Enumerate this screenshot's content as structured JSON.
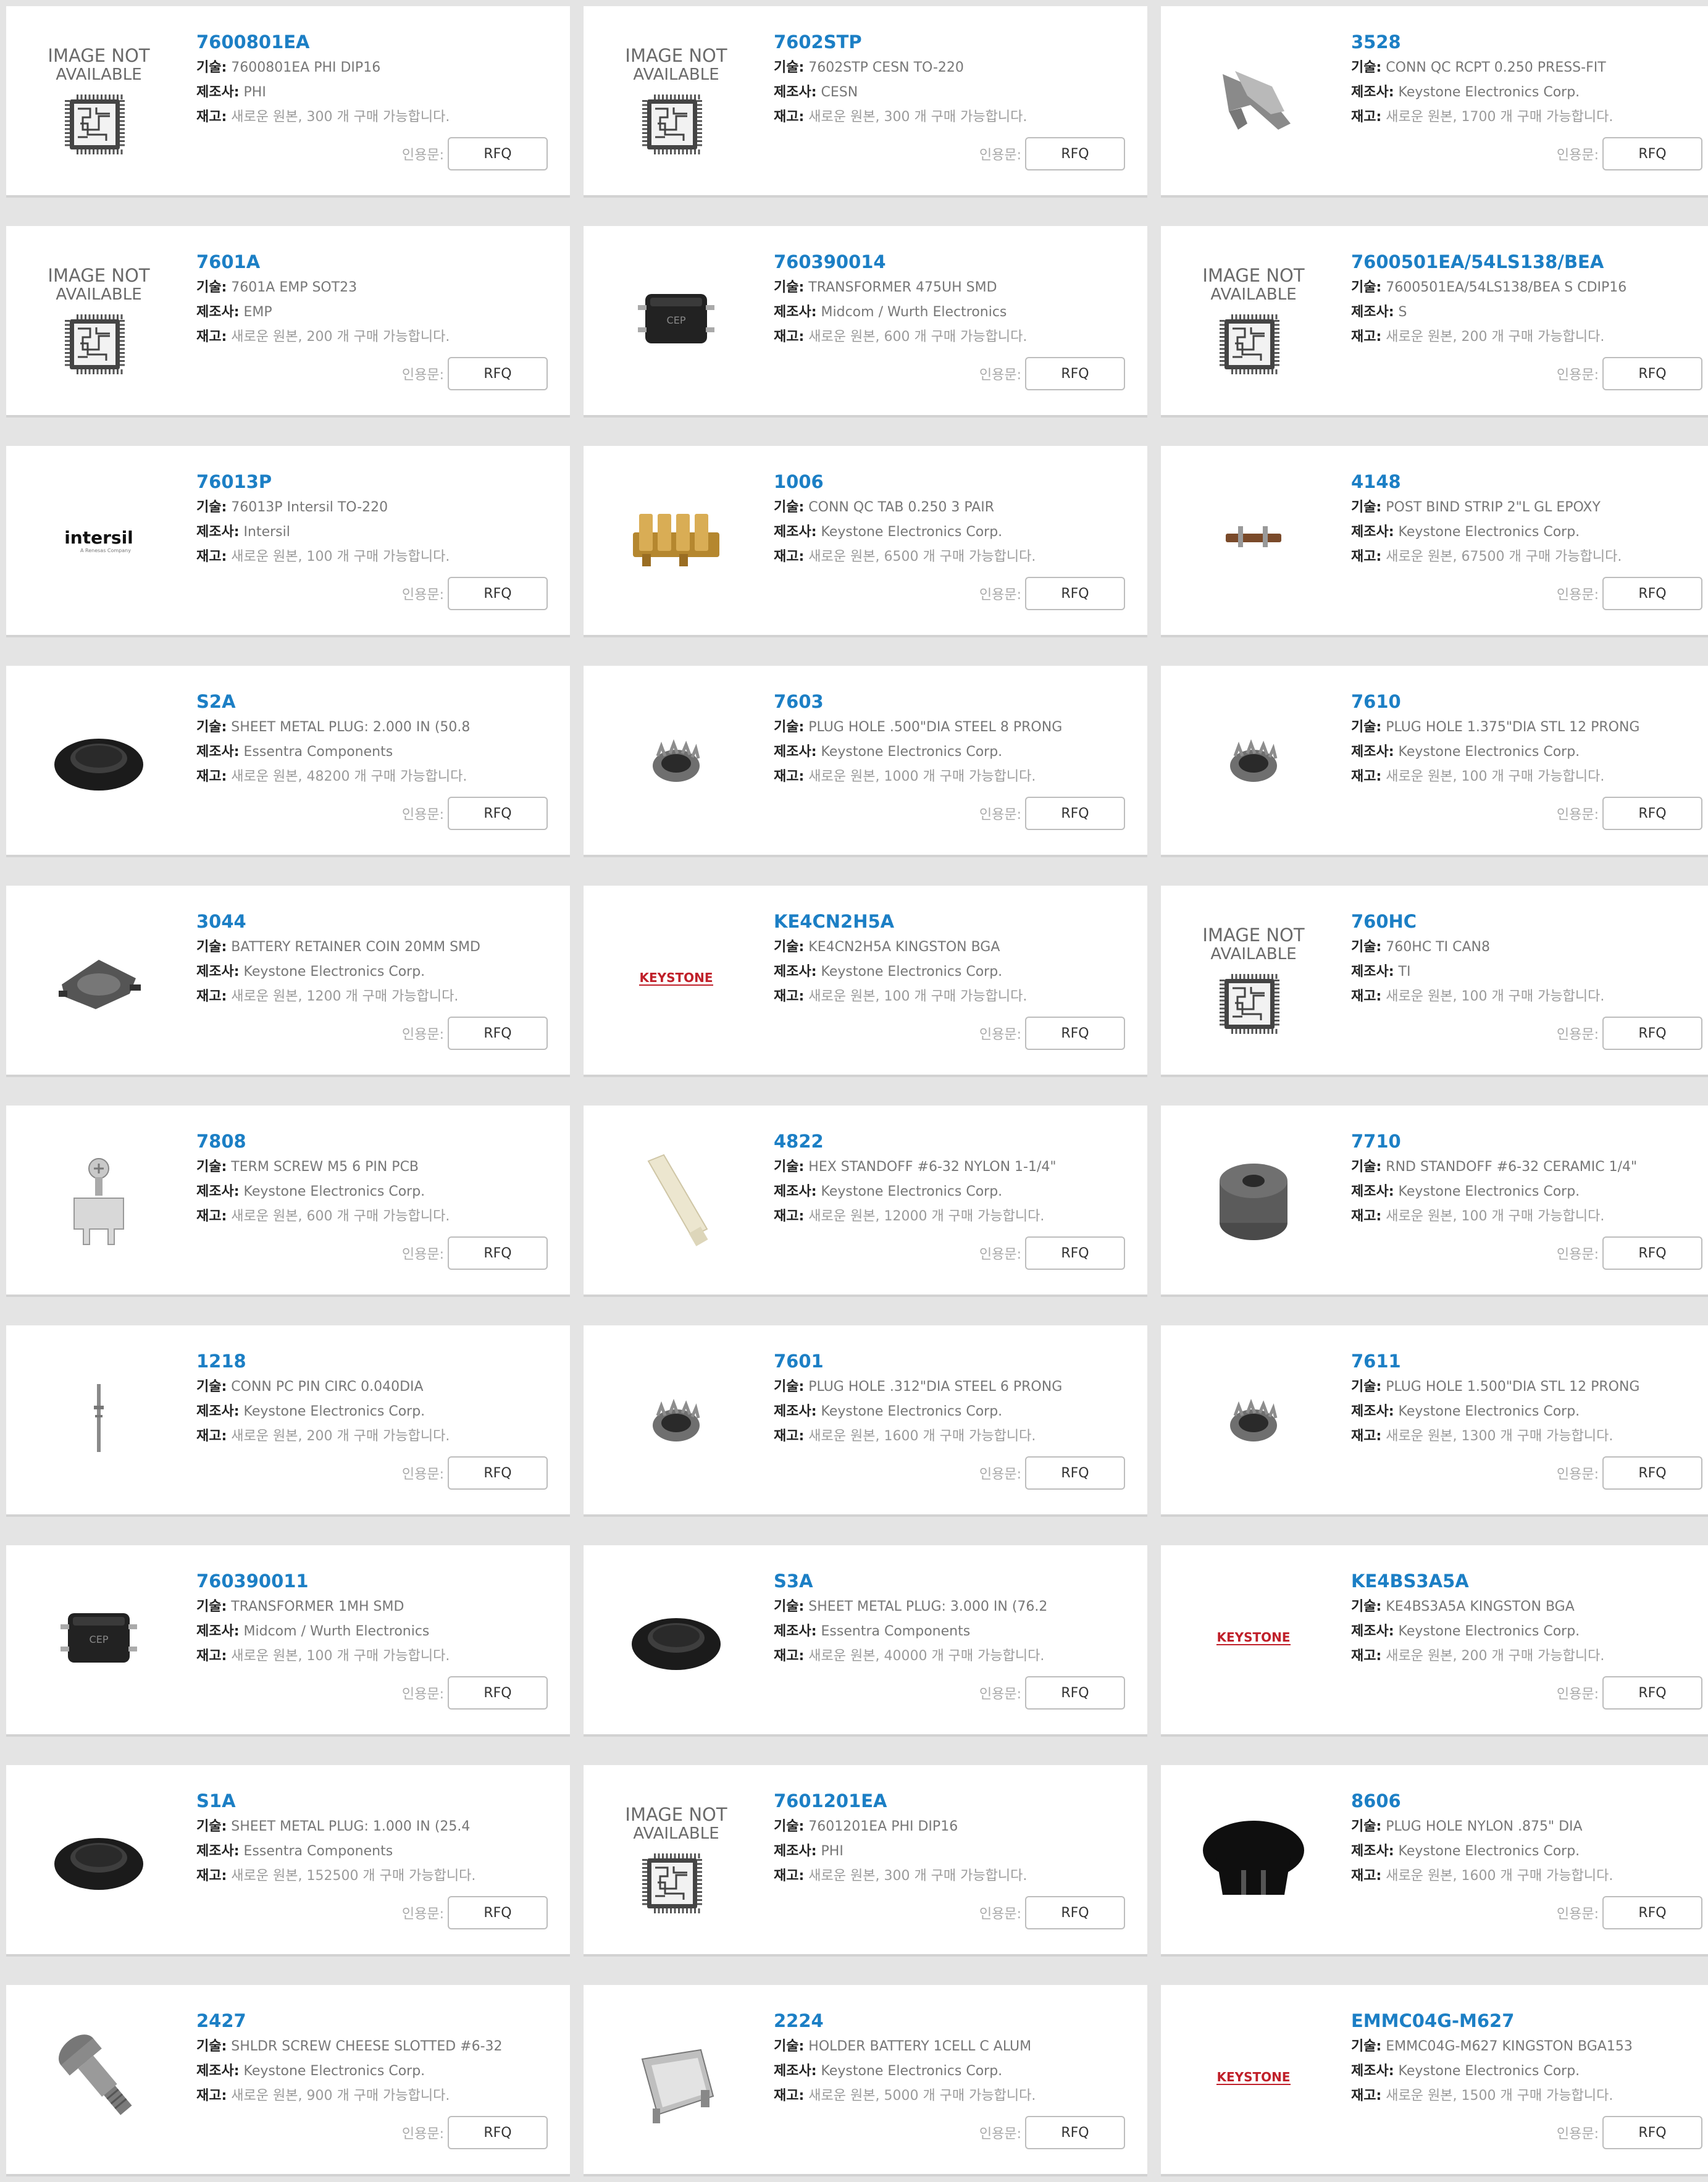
{
  "labels": {
    "desc": "기술:",
    "mfr": "제조사:",
    "stock": "재고:",
    "quote": "인용문:",
    "rfq": "RFQ",
    "stock_tmpl": "새로운 원본, {n} 개 구매 가능합니다.",
    "image_na_line1": "IMAGE NOT",
    "image_na_line2": "AVAILABLE"
  },
  "products": [
    {
      "pn": "7600801EA",
      "desc": "7600801EA PHI DIP16",
      "mfr": "PHI",
      "stock": "300",
      "img": "image-not-available"
    },
    {
      "pn": "7602STP",
      "desc": "7602STP CESN TO-220",
      "mfr": "CESN",
      "stock": "300",
      "img": "image-not-available"
    },
    {
      "pn": "3528",
      "desc": "CONN QC RCPT 0.250 PRESS-FIT",
      "mfr": "Keystone Electronics Corp.",
      "stock": "1700",
      "img": "qc-receptacle"
    },
    {
      "pn": "7601A",
      "desc": "7601A EMP SOT23",
      "mfr": "EMP",
      "stock": "200",
      "img": "image-not-available"
    },
    {
      "pn": "760390014",
      "desc": "TRANSFORMER 475UH SMD",
      "mfr": "Midcom / Wurth Electronics",
      "stock": "600",
      "img": "smd-transformer"
    },
    {
      "pn": "7600501EA/54LS138/BEA",
      "desc": "7600501EA/54LS138/BEA S CDIP16",
      "mfr": "S",
      "stock": "200",
      "img": "image-not-available"
    },
    {
      "pn": "76013P",
      "desc": "76013P Intersil TO-220",
      "mfr": "Intersil",
      "stock": "100",
      "img": "intersil-logo"
    },
    {
      "pn": "1006",
      "desc": "CONN QC TAB 0.250 3 PAIR",
      "mfr": "Keystone Electronics Corp.",
      "stock": "6500",
      "img": "qc-tab"
    },
    {
      "pn": "4148",
      "desc": "POST BIND STRIP 2\"L GL EPOXY",
      "mfr": "Keystone Electronics Corp.",
      "stock": "67500",
      "img": "binding-strip"
    },
    {
      "pn": "S2A",
      "desc": "SHEET METAL PLUG: 2.000 IN (50.8",
      "mfr": "Essentra Components",
      "stock": "48200",
      "img": "sheet-plug"
    },
    {
      "pn": "7603",
      "desc": "PLUG HOLE .500\"DIA STEEL 8 PRONG",
      "mfr": "Keystone Electronics Corp.",
      "stock": "1000",
      "img": "prong-plug"
    },
    {
      "pn": "7610",
      "desc": "PLUG HOLE 1.375\"DIA STL 12 PRONG",
      "mfr": "Keystone Electronics Corp.",
      "stock": "100",
      "img": "prong-plug"
    },
    {
      "pn": "3044",
      "desc": "BATTERY RETAINER COIN 20MM SMD",
      "mfr": "Keystone Electronics Corp.",
      "stock": "1200",
      "img": "coin-retainer"
    },
    {
      "pn": "KE4CN2H5A",
      "desc": "KE4CN2H5A KINGSTON BGA",
      "mfr": "Keystone Electronics Corp.",
      "stock": "100",
      "img": "keystone-logo"
    },
    {
      "pn": "760HC",
      "desc": "760HC TI CAN8",
      "mfr": "TI",
      "stock": "100",
      "img": "image-not-available"
    },
    {
      "pn": "7808",
      "desc": "TERM SCREW M5 6 PIN PCB",
      "mfr": "Keystone Electronics Corp.",
      "stock": "600",
      "img": "screw-terminal"
    },
    {
      "pn": "4822",
      "desc": "HEX STANDOFF #6-32 NYLON 1-1/4\"",
      "mfr": "Keystone Electronics Corp.",
      "stock": "12000",
      "img": "nylon-standoff"
    },
    {
      "pn": "7710",
      "desc": "RND STANDOFF #6-32 CERAMIC 1/4\"",
      "mfr": "Keystone Electronics Corp.",
      "stock": "100",
      "img": "ceramic-standoff"
    },
    {
      "pn": "1218",
      "desc": "CONN PC PIN CIRC 0.040DIA",
      "mfr": "Keystone Electronics Corp.",
      "stock": "200",
      "img": "pc-pin"
    },
    {
      "pn": "7601",
      "desc": "PLUG HOLE .312\"DIA STEEL 6 PRONG",
      "mfr": "Keystone Electronics Corp.",
      "stock": "1600",
      "img": "prong-plug"
    },
    {
      "pn": "7611",
      "desc": "PLUG HOLE 1.500\"DIA STL 12 PRONG",
      "mfr": "Keystone Electronics Corp.",
      "stock": "1300",
      "img": "prong-plug"
    },
    {
      "pn": "760390011",
      "desc": "TRANSFORMER 1MH SMD",
      "mfr": "Midcom / Wurth Electronics",
      "stock": "100",
      "img": "smd-transformer"
    },
    {
      "pn": "S3A",
      "desc": "SHEET METAL PLUG: 3.000 IN (76.2",
      "mfr": "Essentra Components",
      "stock": "40000",
      "img": "sheet-plug"
    },
    {
      "pn": "KE4BS3A5A",
      "desc": "KE4BS3A5A KINGSTON BGA",
      "mfr": "Keystone Electronics Corp.",
      "stock": "200",
      "img": "keystone-logo"
    },
    {
      "pn": "S1A",
      "desc": "SHEET METAL PLUG: 1.000 IN (25.4",
      "mfr": "Essentra Components",
      "stock": "152500",
      "img": "sheet-plug"
    },
    {
      "pn": "7601201EA",
      "desc": "7601201EA PHI DIP16",
      "mfr": "PHI",
      "stock": "300",
      "img": "image-not-available"
    },
    {
      "pn": "8606",
      "desc": "PLUG HOLE NYLON .875\" DIA",
      "mfr": "Keystone Electronics Corp.",
      "stock": "1600",
      "img": "nylon-hole-plug"
    },
    {
      "pn": "2427",
      "desc": "SHLDR SCREW CHEESE SLOTTED #6-32",
      "mfr": "Keystone Electronics Corp.",
      "stock": "900",
      "img": "shoulder-screw"
    },
    {
      "pn": "2224",
      "desc": "HOLDER BATTERY 1CELL C ALUM",
      "mfr": "Keystone Electronics Corp.",
      "stock": "5000",
      "img": "battery-holder"
    },
    {
      "pn": "EMMC04G-M627",
      "desc": "EMMC04G-M627 KINGSTON BGA153",
      "mfr": "Keystone Electronics Corp.",
      "stock": "1500",
      "img": "keystone-logo"
    }
  ]
}
